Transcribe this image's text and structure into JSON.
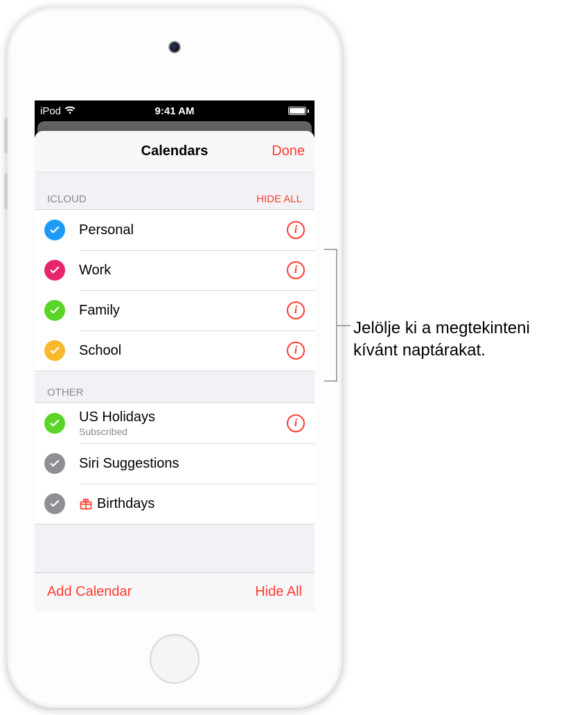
{
  "status_bar": {
    "carrier": "iPod",
    "time": "9:41 AM"
  },
  "modal": {
    "title": "Calendars",
    "done": "Done"
  },
  "sections": {
    "icloud": {
      "title": "ICLOUD",
      "hide_all": "HIDE ALL",
      "items": [
        {
          "label": "Personal",
          "color": "#1b9af7"
        },
        {
          "label": "Work",
          "color": "#e6256b"
        },
        {
          "label": "Family",
          "color": "#5ad427"
        },
        {
          "label": "School",
          "color": "#f7b92b"
        }
      ]
    },
    "other": {
      "title": "OTHER",
      "items": [
        {
          "label": "US Holidays",
          "sub": "Subscribed",
          "color": "#5ad427",
          "info": true
        },
        {
          "label": "Siri Suggestions",
          "color": "#8e8e93",
          "info": false
        },
        {
          "label": "Birthdays",
          "color": "#8e8e93",
          "info": false,
          "gift": true
        }
      ]
    }
  },
  "toolbar": {
    "add": "Add Calendar",
    "hide_all": "Hide All"
  },
  "callout": {
    "text": "Jelölje ki a megtekinteni kívánt naptárakat."
  }
}
